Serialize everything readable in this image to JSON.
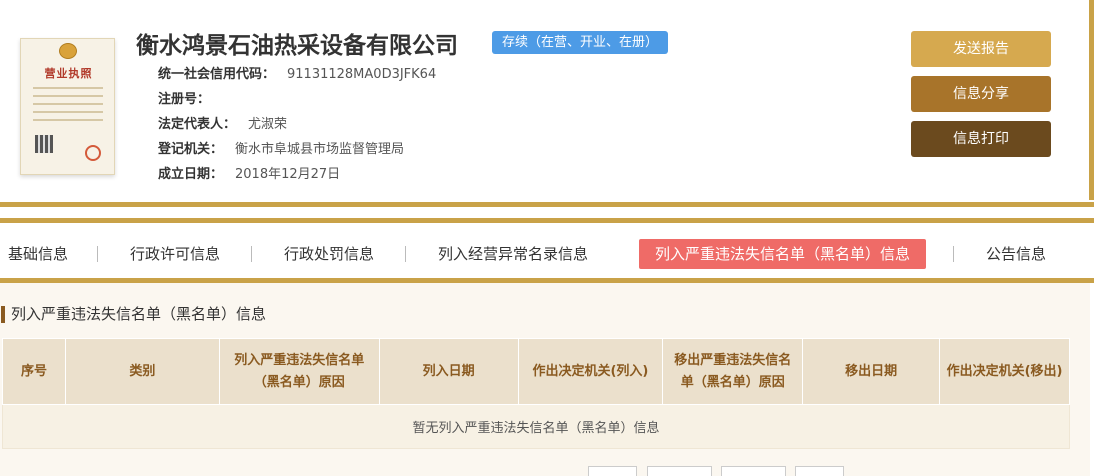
{
  "company": {
    "name": "衡水鸿景石油热采设备有限公司",
    "status": "存续（在营、开业、在册）",
    "license_title": "营业执照"
  },
  "info": [
    {
      "label": "统一社会信用代码：",
      "value": "91131128MA0D3JFK64"
    },
    {
      "label": "注册号：",
      "value": ""
    },
    {
      "label": "法定代表人：",
      "value": "尤淑荣"
    },
    {
      "label": "登记机关：",
      "value": "衡水市阜城县市场监督管理局"
    },
    {
      "label": "成立日期：",
      "value": "2018年12月27日"
    }
  ],
  "actions": {
    "report": "发送报告",
    "share": "信息分享",
    "print": "信息打印"
  },
  "tabs": [
    {
      "label": "基础信息"
    },
    {
      "label": "行政许可信息"
    },
    {
      "label": "行政处罚信息"
    },
    {
      "label": "列入经营异常名录信息"
    },
    {
      "label": "列入严重违法失信名单（黑名单）信息"
    },
    {
      "label": "公告信息"
    }
  ],
  "section": {
    "title": "列入严重违法失信名单（黑名单）信息",
    "headers": [
      "序号",
      "类别",
      "列入严重违法失信名单（黑名单）原因",
      "列入日期",
      "作出决定机关(列入)",
      "移出严重违法失信名单（黑名单）原因",
      "移出日期",
      "作出决定机关(移出)"
    ],
    "empty_text": "暂无列入严重违法失信名单（黑名单）信息"
  },
  "colors": {
    "gold": "#c9a248",
    "status_badge": "#4d9be6",
    "active_tab": "#ef6b67",
    "btn_report": "#d6a94f",
    "btn_share": "#a8742a",
    "btn_print": "#6b4a1e"
  }
}
